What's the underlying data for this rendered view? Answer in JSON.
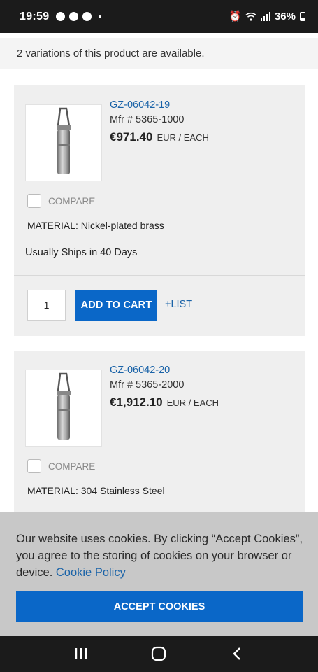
{
  "status_bar": {
    "time": "19:59",
    "battery": "36%"
  },
  "variations": {
    "text": "2 variations of this product are available."
  },
  "products": [
    {
      "sku": "GZ-06042-19",
      "mfr": "Mfr # 5365-1000",
      "price": "€971.40",
      "unit": "EUR / EACH",
      "compare_label": "COMPARE",
      "material_label": "MATERIAL:",
      "material_value": "Nickel-plated brass",
      "material": "MATERIAL: Nickel-plated brass",
      "ships": "Usually Ships in 40 Days",
      "quantity": "1",
      "add_to_cart": "ADD TO CART",
      "list": "+LIST"
    },
    {
      "sku": "GZ-06042-20",
      "mfr": "Mfr # 5365-2000",
      "price": "€1,912.10",
      "unit": "EUR / EACH",
      "compare_label": "COMPARE",
      "material": "MATERIAL: 304 Stainless Steel"
    }
  ],
  "cookie": {
    "text": "Our website uses cookies. By clicking “Accept Cookies”, you agree to the storing of cookies on your browser or device.",
    "link": "Cookie Policy",
    "accept": "ACCEPT COOKIES"
  },
  "nav": {
    "icons": [
      "recents-icon",
      "home-icon",
      "back-icon"
    ]
  }
}
